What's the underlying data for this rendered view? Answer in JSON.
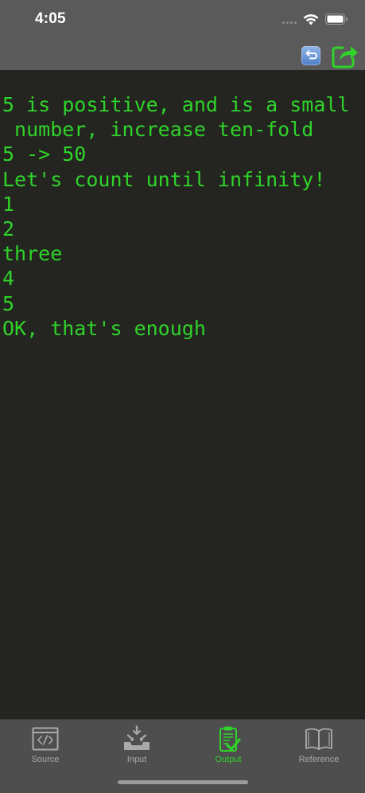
{
  "status_bar": {
    "time": "4:05"
  },
  "toolbar": {
    "restart_icon": "restart-icon",
    "share_icon": "share-icon"
  },
  "console": {
    "lines": [
      "5 is positive, and is a small",
      " number, increase ten-fold",
      "5 -> 50",
      "Let's count until infinity!",
      "1",
      "2",
      "three",
      "4",
      "5",
      "OK, that's enough"
    ]
  },
  "tabs": [
    {
      "label": "Source",
      "icon": "source-code-icon",
      "active": false
    },
    {
      "label": "Input",
      "icon": "input-tray-icon",
      "active": false
    },
    {
      "label": "Output",
      "icon": "output-clipboard-icon",
      "active": true
    },
    {
      "label": "Reference",
      "icon": "book-icon",
      "active": false
    }
  ],
  "colors": {
    "console_text": "#2fd32a",
    "console_background": "#242520",
    "nav_background": "#5a5a5a",
    "tab_bar_background": "#4e4e4e",
    "tab_inactive": "#a9a9a9",
    "tab_active": "#2fd32a"
  }
}
